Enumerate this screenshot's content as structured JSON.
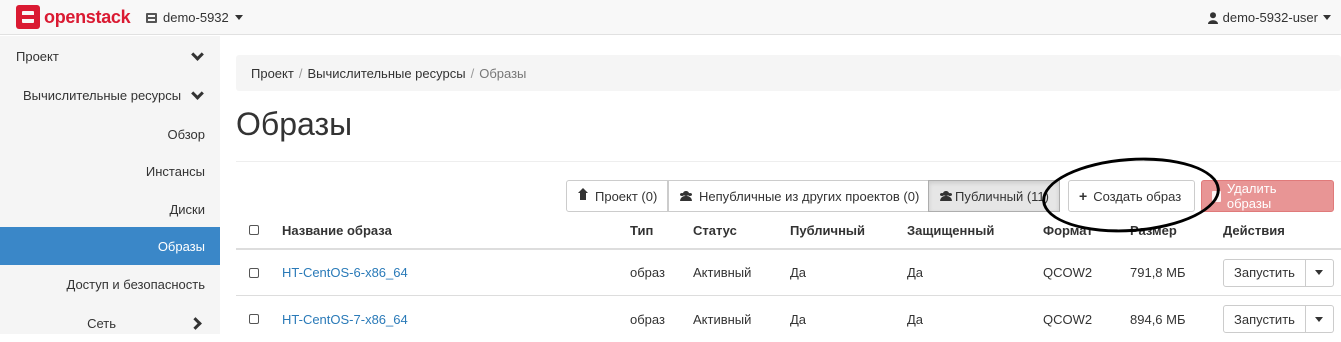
{
  "navbar": {
    "brand": "openstack",
    "project": "demo-5932",
    "user": "demo-5932-user"
  },
  "sidebar": {
    "items": [
      {
        "label": "Проект"
      },
      {
        "label": "Вычислительные ресурсы"
      },
      {
        "label": "Обзор"
      },
      {
        "label": "Инстансы"
      },
      {
        "label": "Диски"
      },
      {
        "label": "Образы",
        "active": true
      },
      {
        "label": "Доступ и безопасность"
      },
      {
        "label": "Сеть"
      }
    ]
  },
  "breadcrumb": {
    "items": [
      "Проект",
      "Вычислительные ресурсы",
      "Образы"
    ]
  },
  "page": {
    "title": "Образы"
  },
  "filters": {
    "project": "Проект (0)",
    "shared": "Непубличные из других проектов (0)",
    "public": "Публичный (11)"
  },
  "actions": {
    "create": "Создать образ",
    "delete": "Удалить образы"
  },
  "table": {
    "headers": [
      "Название образа",
      "Тип",
      "Статус",
      "Публичный",
      "Защищенный",
      "Формат",
      "Размер",
      "Действия"
    ],
    "rows": [
      {
        "name": "HT-CentOS-6-x86_64",
        "type": "образ",
        "status": "Активный",
        "public": "Да",
        "protected": "Да",
        "format": "QCOW2",
        "size": "791,8 МБ",
        "action": "Запустить"
      },
      {
        "name": "HT-CentOS-7-x86_64",
        "type": "образ",
        "status": "Активный",
        "public": "Да",
        "protected": "Да",
        "format": "QCOW2",
        "size": "894,6 МБ",
        "action": "Запустить"
      }
    ]
  },
  "colors": {
    "brand": "#da1a32",
    "active_nav": "#3a87c8",
    "link": "#2a7ab8",
    "danger": "#e89595"
  }
}
